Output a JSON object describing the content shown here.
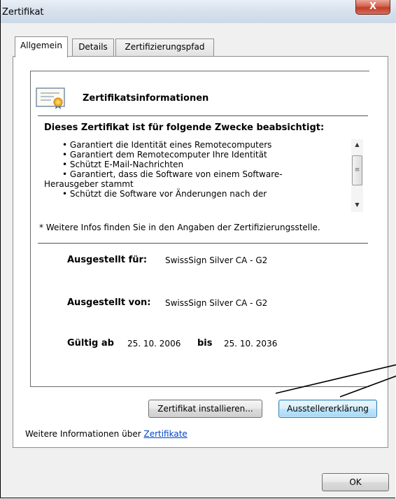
{
  "window": {
    "title": "Zertifikat",
    "close_glyph": "X"
  },
  "tabs": [
    {
      "label": "Allgemein",
      "active": true
    },
    {
      "label": "Details",
      "active": false
    },
    {
      "label": "Zertifizierungspfad",
      "active": false
    }
  ],
  "cert": {
    "icon": "certificate-icon",
    "heading": "Zertifikatsinformationen",
    "purpose_heading": "Dieses Zertifikat ist für folgende Zwecke beabsichtigt:",
    "purposes": [
      "• Garantiert die Identität eines Remotecomputers",
      "• Garantiert dem Remotecomputer Ihre Identität",
      "• Schützt E-Mail-Nachrichten",
      "• Garantiert, dass die Software von einem Software-",
      "Herausgeber stammt",
      "• Schützt die Software vor Änderungen nach der"
    ],
    "footnote": "* Weitere Infos finden Sie in den Angaben der Zertifizierungsstelle.",
    "issued_to_label": "Ausgestellt für:",
    "issued_to_value": "SwissSign Silver CA - G2",
    "issued_by_label": "Ausgestellt von:",
    "issued_by_value": "SwissSign Silver CA - G2",
    "valid_from_label": "Gültig ab",
    "valid_from_value": "25. 10. 2006",
    "valid_to_label": "bis",
    "valid_to_value": "25. 10. 2036"
  },
  "buttons": {
    "install": "Zertifikat installieren...",
    "issuer_statement": "Ausstellererklärung",
    "ok": "OK"
  },
  "more_info": {
    "prefix": "Weitere Informationen über",
    "link": "Zertifikate"
  }
}
